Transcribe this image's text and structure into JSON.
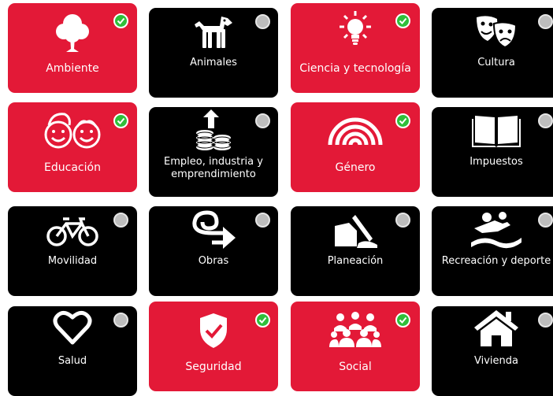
{
  "colors": {
    "selected": "#e31937",
    "unselected": "#000000",
    "check": "#2fbf3a",
    "check_off": "#bdbdbd"
  },
  "tiles": [
    {
      "label": "Ambiente",
      "icon": "tree-icon",
      "selected": true
    },
    {
      "label": "Animales",
      "icon": "dog-icon",
      "selected": false
    },
    {
      "label": "Ciencia y tecnología",
      "icon": "lightbulb-icon",
      "selected": true
    },
    {
      "label": "Cultura",
      "icon": "theater-masks-icon",
      "selected": false
    },
    {
      "label": "Educación",
      "icon": "children-faces-icon",
      "selected": true
    },
    {
      "label": "Empleo, industria y",
      "label2": "emprendimiento",
      "icon": "coins-growth-icon",
      "selected": false
    },
    {
      "label": "Género",
      "icon": "rainbow-icon",
      "selected": true
    },
    {
      "label": "Impuestos",
      "icon": "open-book-icon",
      "selected": false
    },
    {
      "label": "Movilidad",
      "icon": "bicycle-icon",
      "selected": false
    },
    {
      "label": "Obras",
      "icon": "road-arrow-icon",
      "selected": false
    },
    {
      "label": "Planeación",
      "icon": "hand-writing-icon",
      "selected": false
    },
    {
      "label": "Recreación y deporte",
      "icon": "swimmer-icon",
      "selected": false
    },
    {
      "label": "Salud",
      "icon": "heart-icon",
      "selected": false
    },
    {
      "label": "Seguridad",
      "icon": "shield-check-icon",
      "selected": true
    },
    {
      "label": "Social",
      "icon": "people-group-icon",
      "selected": true
    },
    {
      "label": "Vivienda",
      "icon": "house-icon",
      "selected": false
    }
  ]
}
